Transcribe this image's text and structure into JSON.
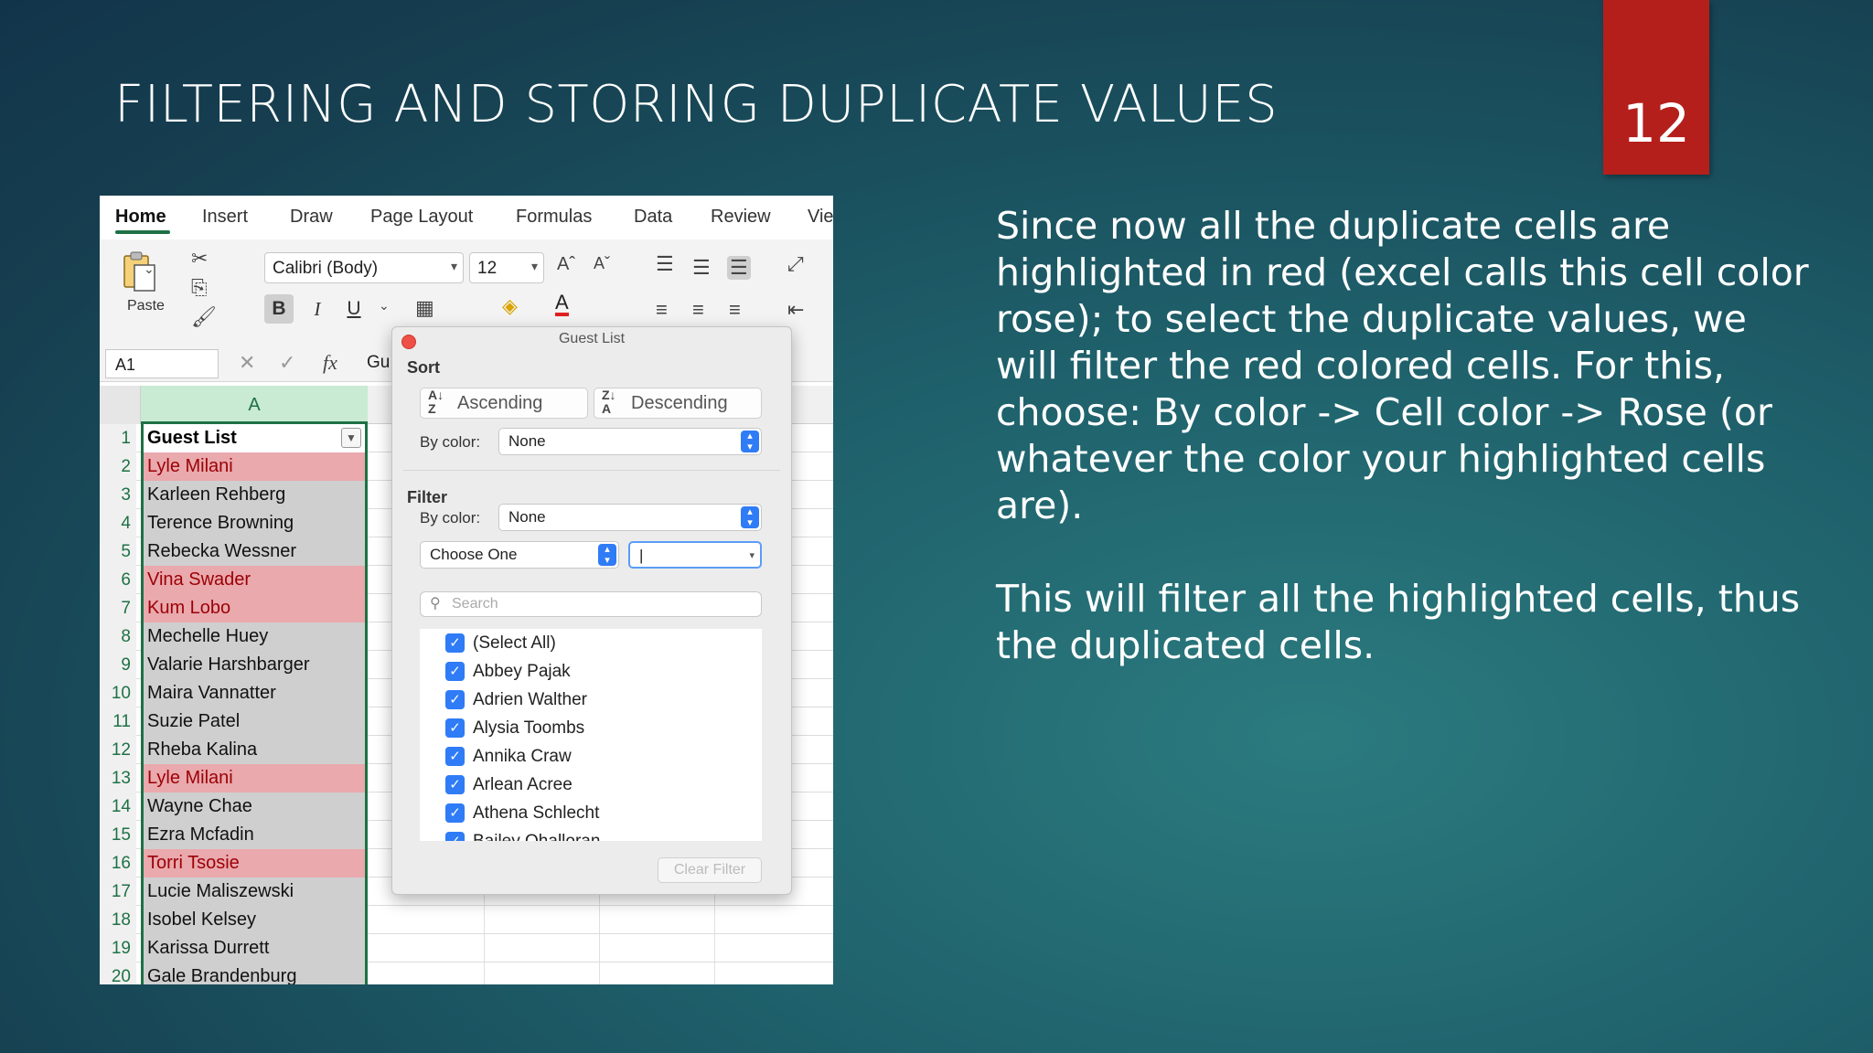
{
  "slide": {
    "title": "FILTERING AND STORING DUPLICATE VALUES",
    "page_number": "12",
    "paragraphs": [
      "Since now all the duplicate cells are highlighted in red (excel calls this cell color rose); to select the duplicate values, we will filter the red colored cells. For this, choose: By color -> Cell color -> Rose (or whatever the color your highlighted cells are).",
      "This will filter all the highlighted cells, thus the duplicated cells."
    ]
  },
  "excel": {
    "tabs": [
      "Home",
      "Insert",
      "Draw",
      "Page Layout",
      "Formulas",
      "Data",
      "Review",
      "Vie"
    ],
    "paste_label": "Paste",
    "font_name": "Calibri (Body)",
    "font_size": "12",
    "name_box": "A1",
    "fx_label": "fx",
    "formula_text": "Gu",
    "column_header": "A",
    "rows": [
      {
        "num": "1",
        "name": "Guest List",
        "type": "header"
      },
      {
        "num": "2",
        "name": "Lyle Milani",
        "type": "dup"
      },
      {
        "num": "3",
        "name": "Karleen Rehberg",
        "type": "normal"
      },
      {
        "num": "4",
        "name": "Terence Browning",
        "type": "normal"
      },
      {
        "num": "5",
        "name": "Rebecka Wessner",
        "type": "normal"
      },
      {
        "num": "6",
        "name": "Vina Swader",
        "type": "dup"
      },
      {
        "num": "7",
        "name": "Kum Lobo",
        "type": "dup"
      },
      {
        "num": "8",
        "name": "Mechelle Huey",
        "type": "normal"
      },
      {
        "num": "9",
        "name": "Valarie Harshbarger",
        "type": "normal"
      },
      {
        "num": "10",
        "name": "Maira Vannatter",
        "type": "normal"
      },
      {
        "num": "11",
        "name": "Suzie Patel",
        "type": "normal"
      },
      {
        "num": "12",
        "name": "Rheba Kalina",
        "type": "normal"
      },
      {
        "num": "13",
        "name": "Lyle Milani",
        "type": "dup"
      },
      {
        "num": "14",
        "name": "Wayne Chae",
        "type": "normal"
      },
      {
        "num": "15",
        "name": "Ezra Mcfadin",
        "type": "normal"
      },
      {
        "num": "16",
        "name": "Torri Tsosie",
        "type": "dup"
      },
      {
        "num": "17",
        "name": "Lucie Maliszewski",
        "type": "normal"
      },
      {
        "num": "18",
        "name": "Isobel Kelsey",
        "type": "normal"
      },
      {
        "num": "19",
        "name": "Karissa Durrett",
        "type": "normal"
      },
      {
        "num": "20",
        "name": "Gale Brandenburg",
        "type": "normal"
      }
    ]
  },
  "filter_popover": {
    "title": "Guest List",
    "sort_label": "Sort",
    "ascending": "Ascending",
    "descending": "Descending",
    "sort_by_color_label": "By color:",
    "sort_by_color_value": "None",
    "filter_label": "Filter",
    "filter_by_color_label": "By color:",
    "filter_by_color_value": "None",
    "condition_value": "Choose One",
    "search_placeholder": "Search",
    "items": [
      "(Select All)",
      "Abbey Pajak",
      "Adrien Walther",
      "Alysia Toombs",
      "Annika Craw",
      "Arlean Acree",
      "Athena Schlecht",
      "Bailey Ohalloran"
    ],
    "clear_filter": "Clear Filter"
  },
  "colors": {
    "duplicate_fill": "#e9a9ad",
    "duplicate_text": "#9c0006",
    "accent_green": "#1e7145",
    "page_number_box": "#b41f1c"
  }
}
